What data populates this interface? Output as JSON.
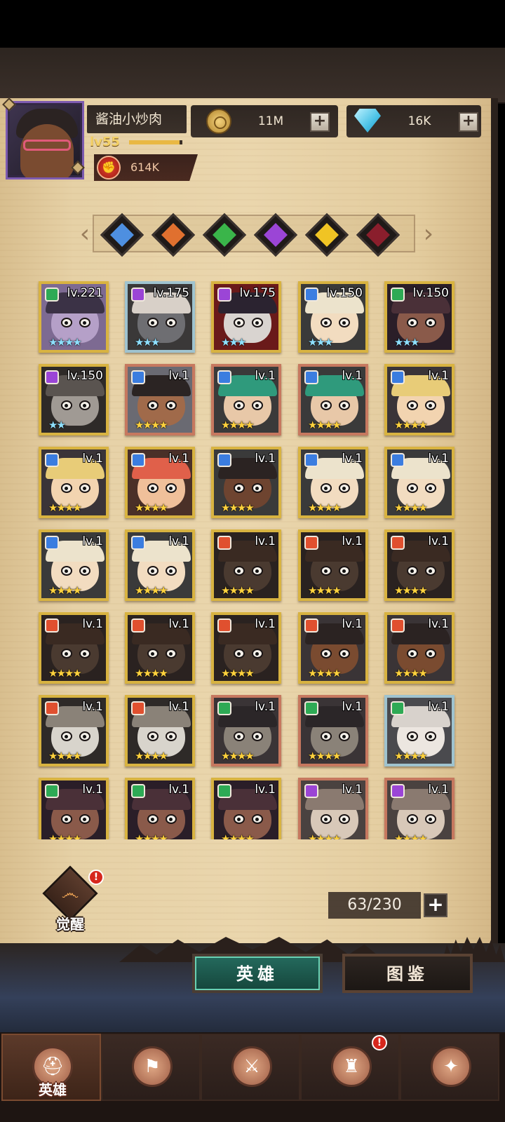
{
  "player": {
    "name": "酱油小炒肉",
    "level": "lv55",
    "exp_fraction": 0.95,
    "power": "614K"
  },
  "resources": {
    "gold": "11M",
    "gems": "16K"
  },
  "filters": [
    {
      "name": "filter-blue-icon",
      "color": "#4e8fe0"
    },
    {
      "name": "filter-orange-icon",
      "color": "#e0702f"
    },
    {
      "name": "filter-green-icon",
      "color": "#3ab54a"
    },
    {
      "name": "filter-purple-icon",
      "color": "#9b45d6"
    },
    {
      "name": "filter-yellow-icon",
      "color": "#f0c424"
    },
    {
      "name": "filter-red-icon",
      "color": "#8a1e2c"
    }
  ],
  "heroes": [
    {
      "level": "lv.221",
      "frame": "gold",
      "badge": "#2eaa55",
      "stars": "★★★★",
      "star_color": "silver",
      "skin": "#b5a0c8",
      "hat": "#3b3246",
      "bg": "#7d6a92"
    },
    {
      "level": "lv.175",
      "frame": "blue",
      "badge": "#9b45d6",
      "stars": "★★★",
      "star_color": "silver",
      "skin": "#6e6e72",
      "hat": "#d8d0c8",
      "bg": "#3a3838"
    },
    {
      "level": "lv.175",
      "frame": "gold",
      "badge": "#9b45d6",
      "stars": "★★★",
      "star_color": "silver",
      "skin": "#d9d4d0",
      "hat": "#2b2330",
      "bg": "#6a1a1a"
    },
    {
      "level": "lv.150",
      "frame": "gold",
      "badge": "#3b7de0",
      "stars": "★★★",
      "star_color": "silver",
      "skin": "#f2dcc0",
      "hat": "#ece3cc",
      "bg": "#3a3a3a"
    },
    {
      "level": "lv.150",
      "frame": "gold",
      "badge": "#2eaa55",
      "stars": "★★★",
      "star_color": "silver",
      "skin": "#8a5a4a",
      "hat": "#4a3038",
      "bg": "#2a1e28"
    },
    {
      "level": "lv.150",
      "frame": "gold",
      "badge": "#9b45d6",
      "stars": "★★",
      "star_color": "silver",
      "skin": "#a09a94",
      "hat": "#5a5450",
      "bg": "#2e2a28"
    },
    {
      "level": "lv.1",
      "frame": "red",
      "badge": "#3b7de0",
      "stars": "★★★★",
      "star_color": "gold",
      "skin": "#a06a4a",
      "hat": "#2b2423",
      "bg": "#6a6a72"
    },
    {
      "level": "lv.1",
      "frame": "red",
      "badge": "#3b7de0",
      "stars": "★★★★",
      "star_color": "gold",
      "skin": "#e8c8a8",
      "hat": "#2f9a7c",
      "bg": "#3a3a3a"
    },
    {
      "level": "lv.1",
      "frame": "red",
      "badge": "#3b7de0",
      "stars": "★★★★",
      "star_color": "gold",
      "skin": "#e8c8a8",
      "hat": "#2f9a7c",
      "bg": "#3a3a3a"
    },
    {
      "level": "lv.1",
      "frame": "gold",
      "badge": "#3b7de0",
      "stars": "★★★★",
      "star_color": "gold",
      "skin": "#f2d4b0",
      "hat": "#e8cc78",
      "bg": "#3a3438"
    },
    {
      "level": "lv.1",
      "frame": "gold",
      "badge": "#3b7de0",
      "stars": "★★★★",
      "star_color": "gold",
      "skin": "#f2d4b0",
      "hat": "#e8cc78",
      "bg": "#3a3438"
    },
    {
      "level": "lv.1",
      "frame": "gold",
      "badge": "#3b7de0",
      "stars": "★★★★",
      "star_color": "gold",
      "skin": "#f0c09a",
      "hat": "#e0604a",
      "bg": "#4a3028"
    },
    {
      "level": "lv.1",
      "frame": "gold",
      "badge": "#3b7de0",
      "stars": "★★★★",
      "star_color": "gold",
      "skin": "#6e4430",
      "hat": "#2b2322",
      "bg": "#3a3a3a"
    },
    {
      "level": "lv.1",
      "frame": "gold",
      "badge": "#3b7de0",
      "stars": "★★★★",
      "star_color": "gold",
      "skin": "#f2dcc0",
      "hat": "#ece3cc",
      "bg": "#3a3a3a"
    },
    {
      "level": "lv.1",
      "frame": "gold",
      "badge": "#3b7de0",
      "stars": "★★★★",
      "star_color": "gold",
      "skin": "#f2dcc0",
      "hat": "#ece3cc",
      "bg": "#3a3a3a"
    },
    {
      "level": "lv.1",
      "frame": "gold",
      "badge": "#3b7de0",
      "stars": "★★★★",
      "star_color": "gold",
      "skin": "#f2dcc0",
      "hat": "#ece3cc",
      "bg": "#3a3a3a"
    },
    {
      "level": "lv.1",
      "frame": "gold",
      "badge": "#3b7de0",
      "stars": "★★★★",
      "star_color": "gold",
      "skin": "#f2dcc0",
      "hat": "#ece3cc",
      "bg": "#3a3a3a"
    },
    {
      "level": "lv.1",
      "frame": "gold",
      "badge": "#e0502f",
      "stars": "★★★★",
      "star_color": "gold",
      "skin": "#4a3a30",
      "hat": "#3a2a22",
      "bg": "#2a2220"
    },
    {
      "level": "lv.1",
      "frame": "gold",
      "badge": "#e0502f",
      "stars": "★★★★",
      "star_color": "gold",
      "skin": "#4a3a30",
      "hat": "#3a2a22",
      "bg": "#2a2220"
    },
    {
      "level": "lv.1",
      "frame": "gold",
      "badge": "#e0502f",
      "stars": "★★★★",
      "star_color": "gold",
      "skin": "#4a3a30",
      "hat": "#3a2a22",
      "bg": "#2a2220"
    },
    {
      "level": "lv.1",
      "frame": "gold",
      "badge": "#e0502f",
      "stars": "★★★★",
      "star_color": "gold",
      "skin": "#4a3a30",
      "hat": "#3a2a22",
      "bg": "#2a2220"
    },
    {
      "level": "lv.1",
      "frame": "gold",
      "badge": "#e0502f",
      "stars": "★★★★",
      "star_color": "gold",
      "skin": "#4a3a30",
      "hat": "#3a2a22",
      "bg": "#2a2220"
    },
    {
      "level": "lv.1",
      "frame": "gold",
      "badge": "#e0502f",
      "stars": "★★★★",
      "star_color": "gold",
      "skin": "#4a3a30",
      "hat": "#3a2a22",
      "bg": "#2a2220"
    },
    {
      "level": "lv.1",
      "frame": "gold",
      "badge": "#e0502f",
      "stars": "★★★★",
      "star_color": "gold",
      "skin": "#7a4b30",
      "hat": "#2b2322",
      "bg": "#3a3436"
    },
    {
      "level": "lv.1",
      "frame": "gold",
      "badge": "#e0502f",
      "stars": "★★★★",
      "star_color": "gold",
      "skin": "#7a4b30",
      "hat": "#2b2322",
      "bg": "#3a3436"
    },
    {
      "level": "lv.1",
      "frame": "gold",
      "badge": "#e0502f",
      "stars": "★★★★",
      "star_color": "gold",
      "skin": "#d8d4cc",
      "hat": "#8a8278",
      "bg": "#2e2a28"
    },
    {
      "level": "lv.1",
      "frame": "gold",
      "badge": "#e0502f",
      "stars": "★★★★",
      "star_color": "gold",
      "skin": "#d8d4cc",
      "hat": "#8a8278",
      "bg": "#2e2a28"
    },
    {
      "level": "lv.1",
      "frame": "red",
      "badge": "#2eaa55",
      "stars": "★★★★",
      "star_color": "gold",
      "skin": "#8a8278",
      "hat": "#2b2628",
      "bg": "#3a3436"
    },
    {
      "level": "lv.1",
      "frame": "red",
      "badge": "#2eaa55",
      "stars": "★★★★",
      "star_color": "gold",
      "skin": "#8a8278",
      "hat": "#2b2628",
      "bg": "#3a3436"
    },
    {
      "level": "lv.1",
      "frame": "blue",
      "badge": "#2eaa55",
      "stars": "★★★★",
      "star_color": "gold",
      "skin": "#ece6e0",
      "hat": "#d8d2cc",
      "bg": "#4a4a4e"
    },
    {
      "level": "lv.1",
      "frame": "gold",
      "badge": "#2eaa55",
      "stars": "★★★★",
      "star_color": "gold",
      "skin": "#8a5a4a",
      "hat": "#4a3038",
      "bg": "#2a1e28"
    },
    {
      "level": "lv.1",
      "frame": "gold",
      "badge": "#2eaa55",
      "stars": "★★★★",
      "star_color": "gold",
      "skin": "#8a5a4a",
      "hat": "#4a3038",
      "bg": "#2a1e28"
    },
    {
      "level": "lv.1",
      "frame": "gold",
      "badge": "#2eaa55",
      "stars": "★★★★",
      "star_color": "gold",
      "skin": "#8a5a4a",
      "hat": "#4a3038",
      "bg": "#2a1e28"
    },
    {
      "level": "lv.1",
      "frame": "red",
      "badge": "#9b45d6",
      "stars": "★★★★",
      "star_color": "gold",
      "skin": "#d8c8b8",
      "hat": "#8a7a70",
      "bg": "#4a4240"
    },
    {
      "level": "lv.1",
      "frame": "red",
      "badge": "#9b45d6",
      "stars": "★★★★",
      "star_color": "gold",
      "skin": "#d8c8b8",
      "hat": "#8a7a70",
      "bg": "#4a4240"
    }
  ],
  "awaken": {
    "label": "觉醒",
    "alert": "!"
  },
  "hero_count": "63/230",
  "tabs": {
    "heroes": "英雄",
    "codex": "图鉴"
  },
  "nav": [
    {
      "name": "nav-heroes",
      "label": "英雄",
      "icon": "knight-helmet-icon",
      "glyph": "⛑",
      "alert": false
    },
    {
      "name": "nav-adventure",
      "label": "",
      "icon": "flag-icon",
      "glyph": "⚑",
      "alert": false
    },
    {
      "name": "nav-battle",
      "label": "",
      "icon": "crossed-swords-icon",
      "glyph": "⚔",
      "alert": false
    },
    {
      "name": "nav-castle",
      "label": "",
      "icon": "castle-icon",
      "glyph": "♜",
      "alert": true
    },
    {
      "name": "nav-guild",
      "label": "",
      "icon": "handshake-emblem-icon",
      "glyph": "✦",
      "alert": false
    }
  ]
}
